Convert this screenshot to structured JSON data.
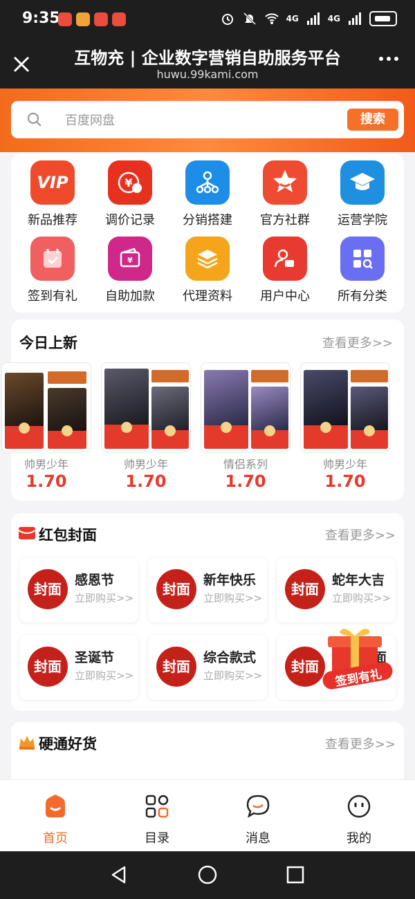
{
  "status_bar": {
    "time": "9:35",
    "signal1": "4G",
    "signal2": "4G"
  },
  "header": {
    "title": "互物充 | 企业数字营销自助服务平台",
    "url": "huwu.99kami.com"
  },
  "search": {
    "placeholder": "百度网盘",
    "button": "搜索"
  },
  "menu": [
    {
      "label": "新品推荐",
      "icon": "vip-icon",
      "color": "#f04a2c"
    },
    {
      "label": "调价记录",
      "icon": "yen-price-icon",
      "color": "#e8301f"
    },
    {
      "label": "分销搭建",
      "icon": "network-icon",
      "color": "#1e8de8"
    },
    {
      "label": "官方社群",
      "icon": "star-smile-icon",
      "color": "#ef4a32"
    },
    {
      "label": "运营学院",
      "icon": "graduation-cap-icon",
      "color": "#1f8fe0"
    },
    {
      "label": "签到有礼",
      "icon": "calendar-check-icon",
      "color": "#f06060"
    },
    {
      "label": "自助加款",
      "icon": "wallet-icon",
      "color": "#d0278a"
    },
    {
      "label": "代理资料",
      "icon": "layers-icon",
      "color": "#f4a51c"
    },
    {
      "label": "用户中心",
      "icon": "user-card-icon",
      "color": "#e83a30"
    },
    {
      "label": "所有分类",
      "icon": "category-grid-icon",
      "color": "#6a6ef0"
    }
  ],
  "new_today": {
    "title": "今日上新",
    "more": "查看更多>>",
    "products": [
      {
        "name": "帅男少年",
        "price": "1.70"
      },
      {
        "name": "帅男少年",
        "price": "1.70"
      },
      {
        "name": "情侣系列",
        "price": "1.70"
      },
      {
        "name": "帅男少年",
        "price": "1.70"
      }
    ]
  },
  "red_envelope": {
    "title": "红包封面",
    "more": "查看更多>>",
    "seal_text": "封面",
    "items": [
      {
        "name": "感恩节",
        "buy": "立即购买>>"
      },
      {
        "name": "新年快乐",
        "buy": "立即购买>>"
      },
      {
        "name": "蛇年大吉",
        "buy": "立即购买>>"
      },
      {
        "name": "圣诞节",
        "buy": "立即购买>>"
      },
      {
        "name": "综合款式",
        "buy": "立即购买>>"
      },
      {
        "name": "面",
        "buy": ""
      }
    ]
  },
  "hard_goods": {
    "title": "硬通好货",
    "more": "查看更多>>"
  },
  "float_badge": {
    "label": "签到有礼"
  },
  "tabs": [
    {
      "label": "首页",
      "icon": "home-icon",
      "active": true
    },
    {
      "label": "目录",
      "icon": "catalog-grid-icon",
      "active": false
    },
    {
      "label": "消息",
      "icon": "message-bubble-icon",
      "active": false
    },
    {
      "label": "我的",
      "icon": "profile-face-icon",
      "active": false
    }
  ],
  "colors": {
    "accent": "#f5712a",
    "price": "#e8382c",
    "seal": "#c4211b"
  }
}
